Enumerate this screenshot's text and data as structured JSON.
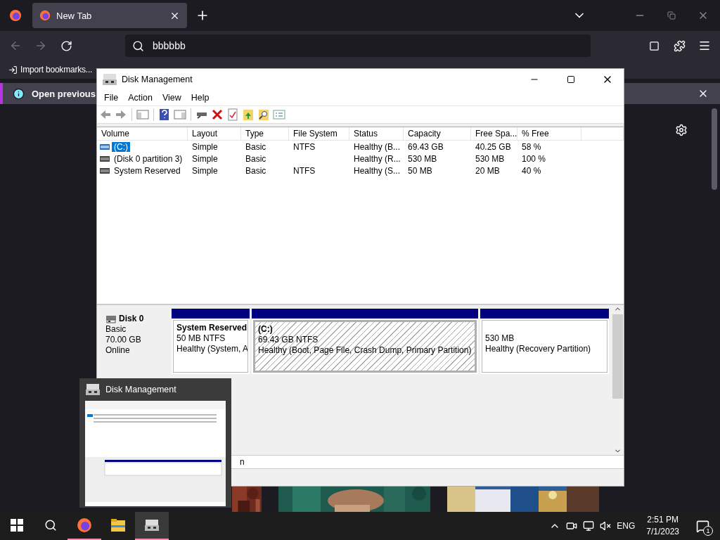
{
  "browser": {
    "tabs": [
      {
        "title": "New Tab",
        "selected": true
      }
    ],
    "address": "bbbbbb",
    "bookmarks": [
      "Import bookmarks..."
    ],
    "notification": "Open previous"
  },
  "disk_management": {
    "title": "Disk Management",
    "menu": [
      "File",
      "Action",
      "View",
      "Help"
    ],
    "columns": [
      "Volume",
      "Layout",
      "Type",
      "File System",
      "Status",
      "Capacity",
      "Free Spa...",
      "% Free"
    ],
    "rows": [
      {
        "volume": "(C:)",
        "layout": "Simple",
        "type": "Basic",
        "file_system": "NTFS",
        "status": "Healthy (B...",
        "capacity": "69.43 GB",
        "free_space": "40.25 GB",
        "percent_free": "58 %",
        "selected": true
      },
      {
        "volume": "(Disk 0 partition 3)",
        "layout": "Simple",
        "type": "Basic",
        "status": "Healthy (R...",
        "capacity": "530 MB",
        "free_space": "530 MB",
        "percent_free": "100 %",
        "selected": false
      },
      {
        "volume": "System Reserved",
        "layout": "Simple",
        "type": "Basic",
        "file_system": "NTFS",
        "status": "Healthy (S...",
        "capacity": "50 MB",
        "free_space": "20 MB",
        "percent_free": "40 %",
        "selected": false
      }
    ],
    "disks": [
      {
        "name": "Disk 0",
        "type": "Basic",
        "size": "70.00 GB",
        "status": "Online",
        "partitions": [
          {
            "name": "System Reserved",
            "size": "50 MB NTFS",
            "status": "Healthy (System, A",
            "selected": false
          },
          {
            "name": "(C:)",
            "size": "69.43 GB NTFS",
            "status": "Healthy (Boot, Page File, Crash Dump, Primary Partition)",
            "selected": true
          },
          {
            "size": "530 MB",
            "status": "Healthy (Recovery Partition)",
            "selected": false
          }
        ]
      }
    ],
    "legend": "n"
  },
  "thumbnail": {
    "title": "Disk Management"
  },
  "taskbar": {
    "apps": [
      {
        "kind": "firefox",
        "running": true,
        "selected": false
      },
      {
        "kind": "explorer",
        "running": false,
        "selected": false
      },
      {
        "kind": "disk",
        "running": true,
        "selected": true
      }
    ],
    "language": "ENG",
    "time": "2:51 PM",
    "date": "7/1/2023",
    "notifications": "1"
  }
}
